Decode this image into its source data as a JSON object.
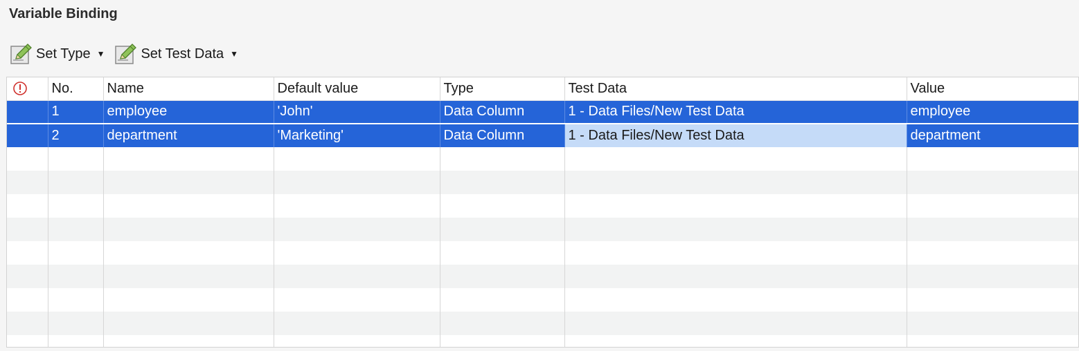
{
  "panel": {
    "title": "Variable Binding"
  },
  "toolbar": {
    "set_type_label": "Set Type",
    "set_test_data_label": "Set Test Data"
  },
  "colors": {
    "selection": "#2564d8",
    "focused_cell": "#c5dbf8",
    "stripe": "#f2f3f3",
    "error_icon": "#d0312d"
  },
  "table": {
    "columns": {
      "status": "",
      "no": "No.",
      "name": "Name",
      "default_value": "Default value",
      "type": "Type",
      "test_data": "Test Data",
      "value": "Value"
    },
    "rows": [
      {
        "no": "1",
        "name": "employee",
        "default_value": "'John'",
        "type": "Data Column",
        "test_data": "1 - Data Files/New Test Data",
        "value": "employee"
      },
      {
        "no": "2",
        "name": "department",
        "default_value": "'Marketing'",
        "type": "Data Column",
        "test_data": "1 - Data Files/New Test Data",
        "value": "department"
      }
    ]
  }
}
